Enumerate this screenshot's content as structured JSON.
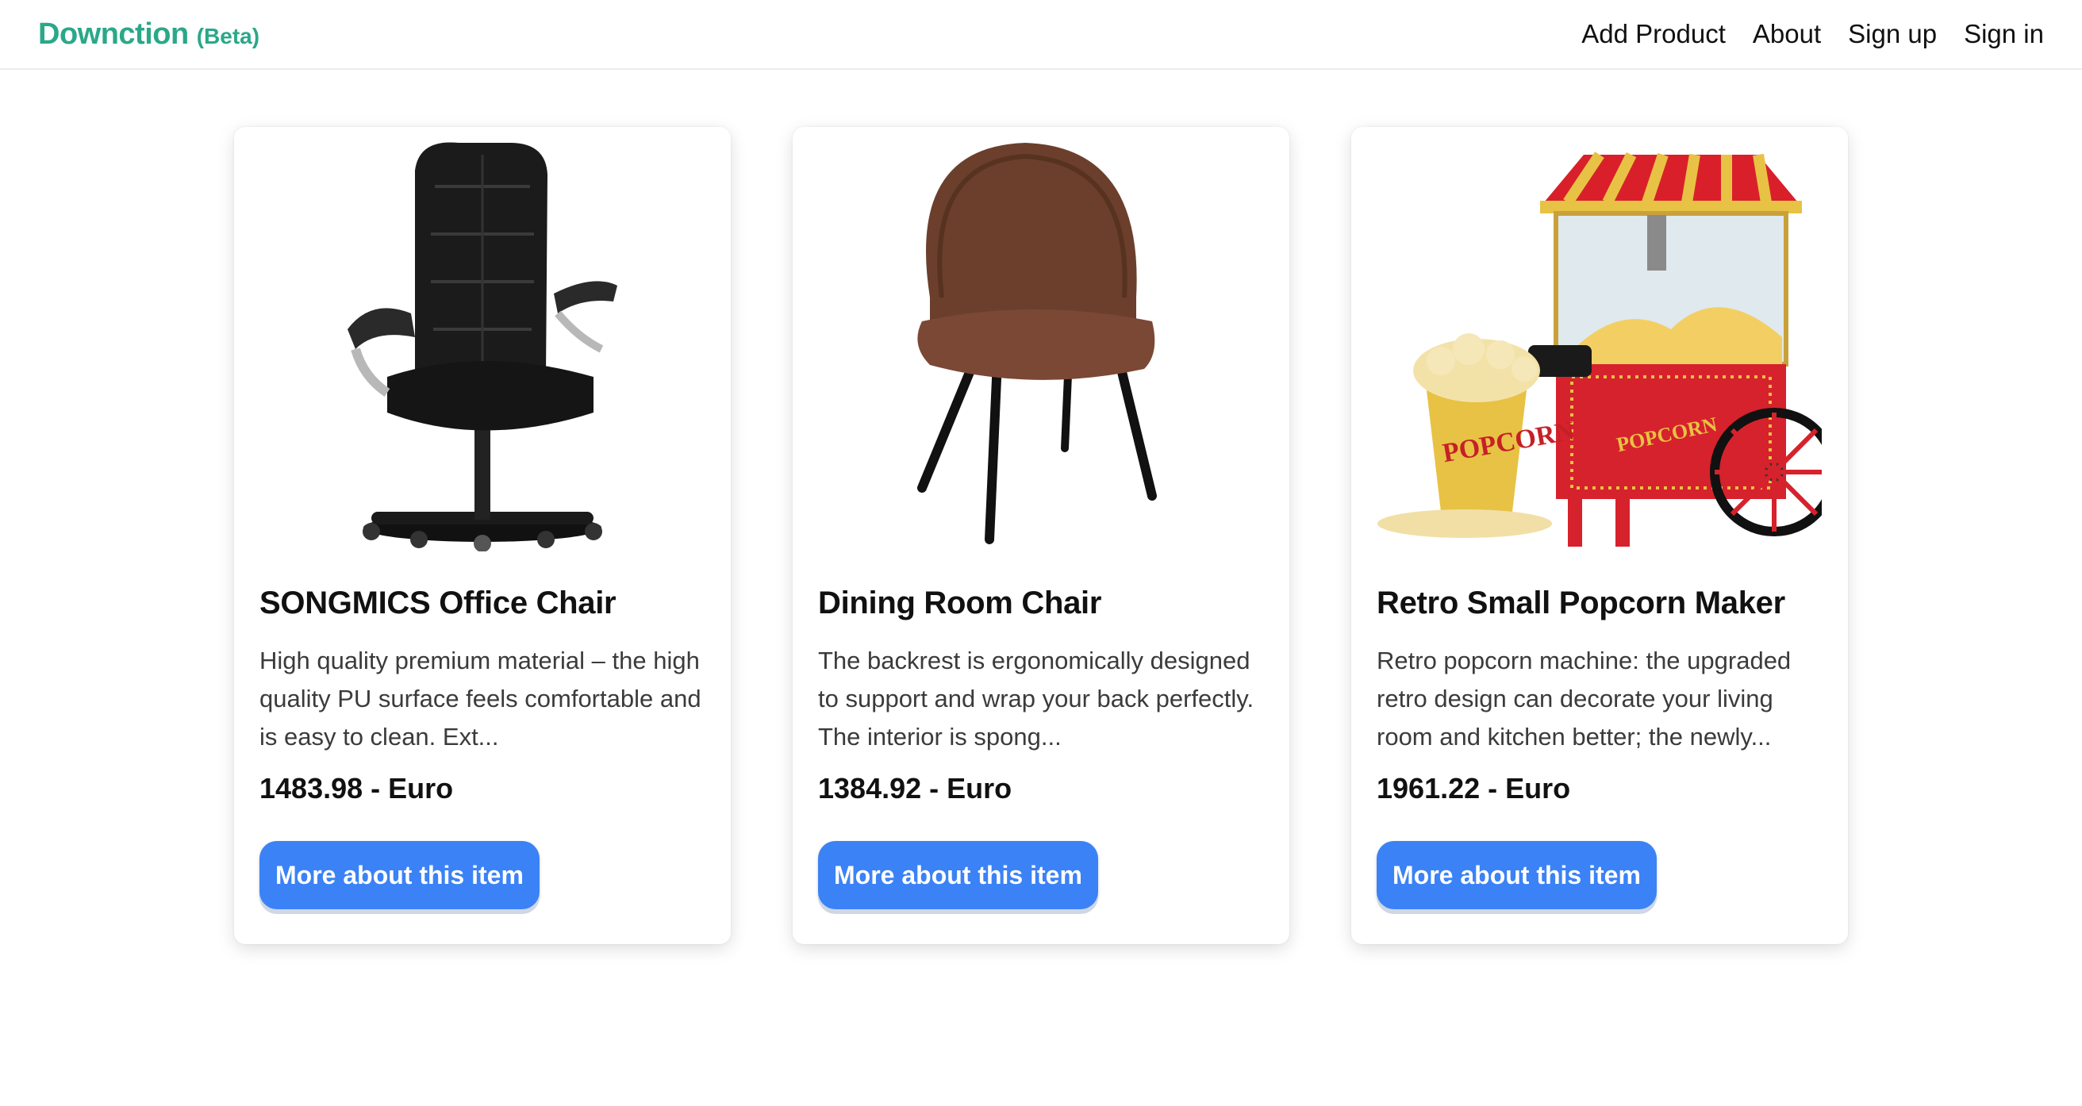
{
  "header": {
    "brand": "Downction",
    "brand_tag": "(Beta)",
    "nav": [
      "Add Product",
      "About",
      "Sign up",
      "Sign in"
    ]
  },
  "products": [
    {
      "title": "SONGMICS Office Chair",
      "description": "High quality premium material – the high quality PU surface feels comfortable and is easy to clean. Ext...",
      "price": "1483.98 - Euro",
      "button": "More about this item",
      "image_icon": "office-chair-icon"
    },
    {
      "title": "Dining Room Chair",
      "description": "The backrest is ergonomically designed to support and wrap your back perfectly. The interior is spong...",
      "price": "1384.92 - Euro",
      "button": "More about this item",
      "image_icon": "dining-chair-icon"
    },
    {
      "title": "Retro Small Popcorn Maker",
      "description": "Retro popcorn machine: the upgraded retro design can decorate your living room and kitchen better; the newly...",
      "price": "1961.22 - Euro",
      "button": "More about this item",
      "image_icon": "popcorn-maker-icon"
    }
  ],
  "image_text": {
    "popcorn_bucket": "POPCORN",
    "popcorn_machine": "POPCORN"
  },
  "colors": {
    "brand": "#2aa889",
    "button": "#3b82f6"
  }
}
